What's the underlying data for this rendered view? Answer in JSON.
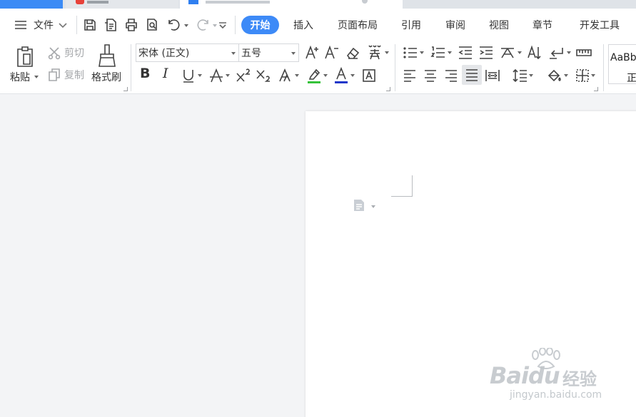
{
  "menu": {
    "file_label": "文件",
    "tabs": [
      {
        "label": "开始",
        "active": true
      },
      {
        "label": "插入",
        "active": false
      },
      {
        "label": "页面布局",
        "active": false
      },
      {
        "label": "引用",
        "active": false
      },
      {
        "label": "审阅",
        "active": false
      },
      {
        "label": "视图",
        "active": false
      },
      {
        "label": "章节",
        "active": false
      },
      {
        "label": "开发工具",
        "active": false
      }
    ]
  },
  "clipboard": {
    "paste_label": "粘贴",
    "cut_label": "剪切",
    "copy_label": "复制",
    "format_painter_label": "格式刷"
  },
  "font": {
    "family": "宋体 (正文)",
    "size": "五号"
  },
  "styles": {
    "sample": "AaBb",
    "name": "正"
  },
  "watermark": {
    "brand": "Baidu",
    "cn": "经验",
    "url": "jingyan.baidu.com"
  },
  "colors": {
    "accent": "#3d8af7",
    "highlight_underline": "#35c23a",
    "font_color_underline": "#2037c9"
  },
  "icons": {
    "menu": "hamburger-icon",
    "save": "save-icon",
    "print": "print-icon",
    "undo": "undo-icon",
    "redo": "redo-icon"
  }
}
